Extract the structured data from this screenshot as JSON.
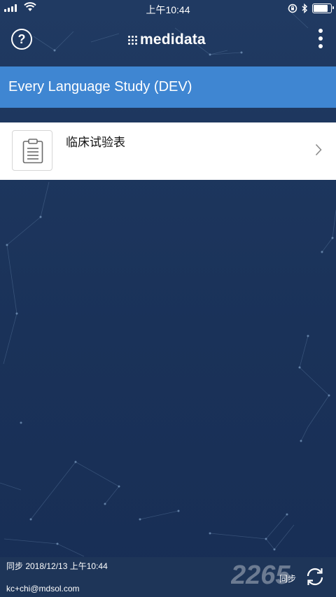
{
  "status_bar": {
    "time": "上午10:44",
    "battery_level": 0.85,
    "icons": [
      "signal-icon",
      "wifi-icon",
      "orientation-lock-icon",
      "bluetooth-icon",
      "battery-icon"
    ]
  },
  "header": {
    "brand": "medidata",
    "help_symbol": "?",
    "icons": [
      "help-icon",
      "brand-grid-icon",
      "more-vertical-icon"
    ]
  },
  "study": {
    "title": "Every Language Study (DEV)"
  },
  "forms": [
    {
      "label": "临床试验表",
      "icon": "clipboard-icon",
      "trailing_icon": "chevron-right-icon"
    }
  ],
  "footer": {
    "sync_status": "同步 2018/12/13 上午10:44",
    "user_email": "kc+chi@mdsol.com",
    "sync_label": "同步",
    "sync_icon": "sync-icon"
  },
  "watermark": {
    "text": "2265"
  },
  "colors": {
    "background": "#1c3359",
    "banner": "#3f86d2",
    "footer": "#1e3558",
    "card": "#ffffff"
  }
}
